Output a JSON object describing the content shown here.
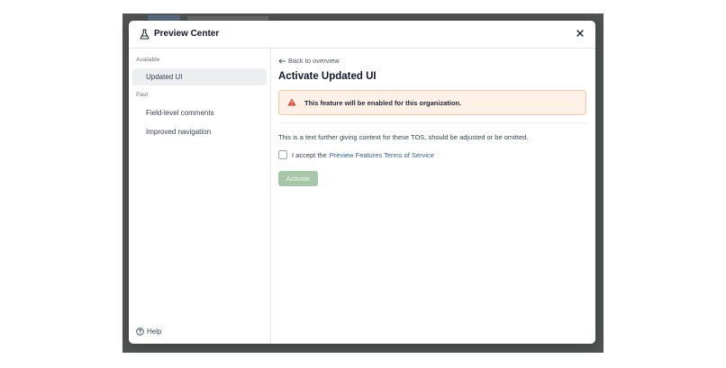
{
  "modal": {
    "title": "Preview Center",
    "icon": "flask-icon",
    "close_icon": "close-icon"
  },
  "sidebar": {
    "available_label": "Available",
    "available_items": [
      {
        "label": "Updated UI",
        "active": true
      }
    ],
    "past_label": "Past",
    "past_items": [
      {
        "label": "Field-level comments"
      },
      {
        "label": "Improved navigation"
      }
    ],
    "help_label": "Help"
  },
  "main": {
    "back_label": "Back to overview",
    "title": "Activate Updated UI",
    "warning": {
      "icon": "warning-icon",
      "text": "This feature will be enabled for this organization.",
      "color": "#fdf0e6",
      "icon_color": "#d9432f"
    },
    "tos_text": "This is a text further giving context for these TOS, should be adjusted or be omitted.",
    "accept_prefix": "I accept the",
    "accept_link": "Preview Features Terms of Service",
    "accept_checked": false,
    "activate_label": "Activate",
    "activate_enabled": false
  },
  "colors": {
    "accent_link": "#2f5d9e",
    "activate_disabled": "#a6c7a8"
  }
}
